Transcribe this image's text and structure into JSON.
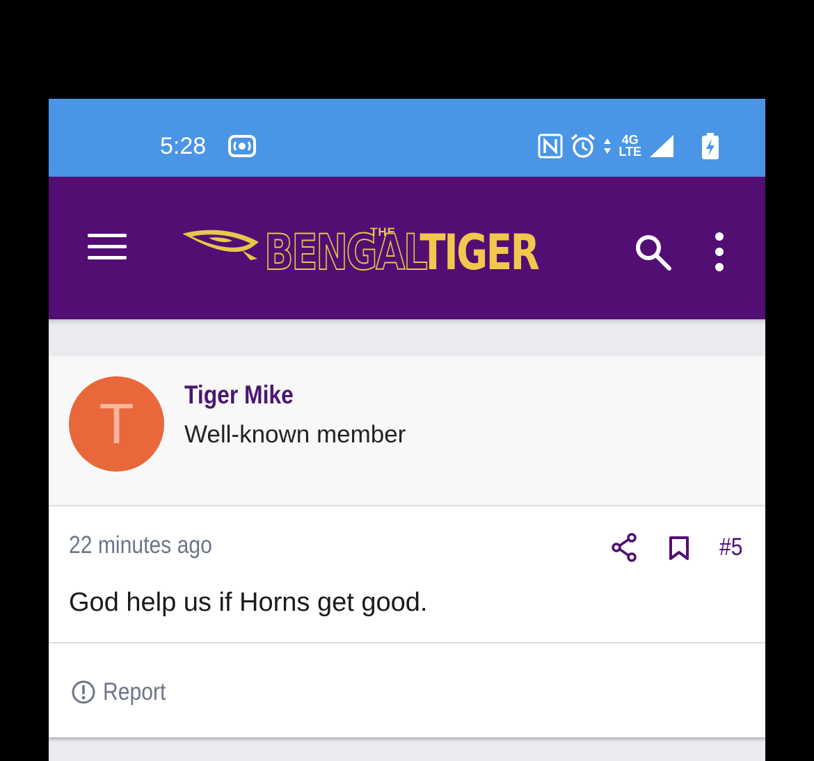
{
  "status_bar": {
    "time": "5:28",
    "network": "4G",
    "network_sub": "LTE"
  },
  "app_bar": {
    "logo_the": "THE",
    "logo_bengal": "BENGAL",
    "logo_tiger": "TIGER",
    "icons": [
      "menu-icon",
      "search-icon",
      "more-vert-icon"
    ],
    "colors": {
      "background": "#520e73",
      "logo_gold": "#f1c84c"
    }
  },
  "post": {
    "author": {
      "initial": "T",
      "name": "Tiger Mike",
      "role": "Well-known member",
      "avatar_color": "#e8683b"
    },
    "timestamp": "22 minutes ago",
    "number": "#5",
    "body": "God help us if Horns get good.",
    "actions": [
      "share-icon",
      "bookmark-icon"
    ]
  },
  "footer": {
    "report_label": "Report"
  }
}
